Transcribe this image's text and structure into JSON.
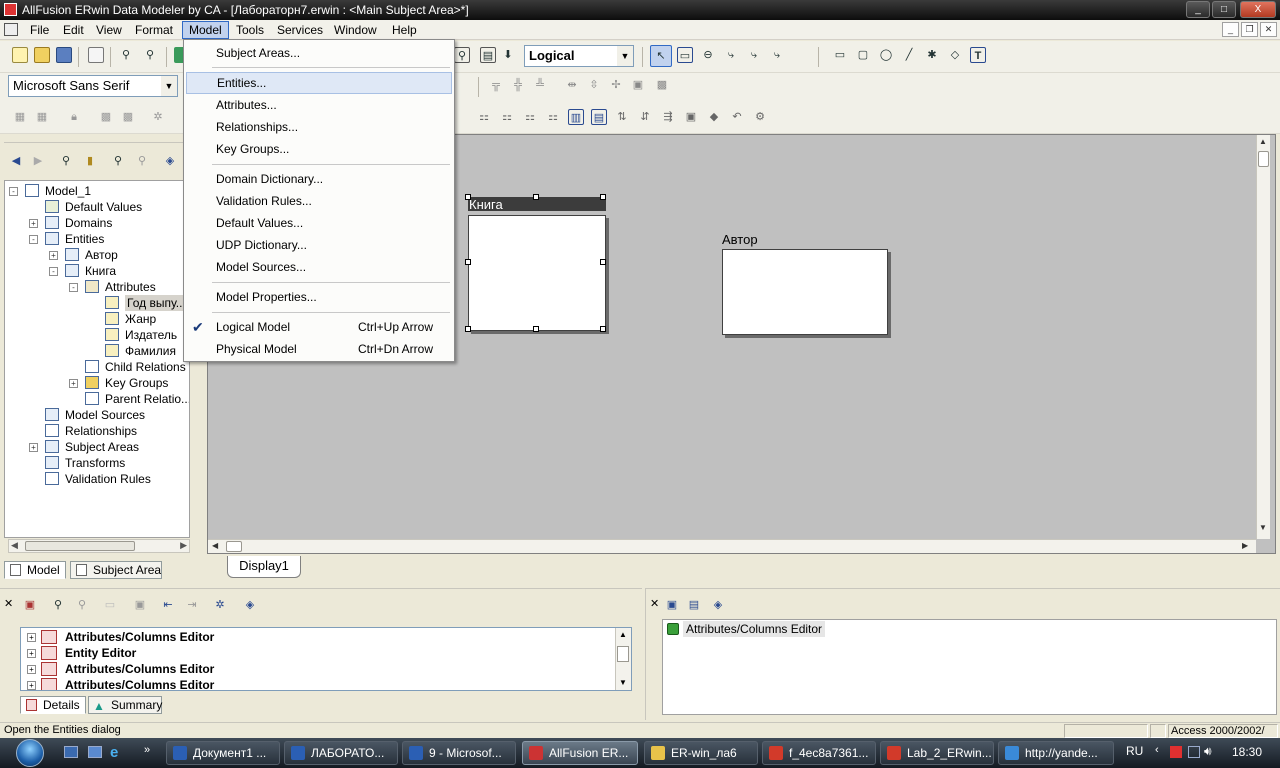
{
  "window": {
    "title": "AllFusion ERwin Data Modeler by CA - [Лабораторн7.erwin : <Main Subject Area>*]",
    "controls": {
      "minimize": "_",
      "maximize": "□",
      "close": "X"
    }
  },
  "menubar": {
    "items": [
      "File",
      "Edit",
      "View",
      "Format",
      "Model",
      "Tools",
      "Services",
      "Window",
      "Help"
    ],
    "active": "Model"
  },
  "toolbar": {
    "model_type_value": "Logical",
    "font_value": "Microsoft Sans Serif"
  },
  "model_menu": {
    "items": [
      {
        "label": "Subject Areas...",
        "shortcut": ""
      },
      {
        "label": "Entities...",
        "shortcut": "",
        "highlighted": true
      },
      {
        "label": "Attributes...",
        "shortcut": ""
      },
      {
        "label": "Relationships...",
        "shortcut": ""
      },
      {
        "label": "Key Groups...",
        "shortcut": ""
      },
      {
        "label": "Domain Dictionary...",
        "shortcut": ""
      },
      {
        "label": "Validation Rules...",
        "shortcut": ""
      },
      {
        "label": "Default Values...",
        "shortcut": ""
      },
      {
        "label": "UDP Dictionary...",
        "shortcut": ""
      },
      {
        "label": "Model Sources...",
        "shortcut": ""
      },
      {
        "label": "Model Properties...",
        "shortcut": ""
      },
      {
        "label": "Logical Model",
        "shortcut": "Ctrl+Up Arrow",
        "checked": true
      },
      {
        "label": "Physical Model",
        "shortcut": "Ctrl+Dn Arrow"
      }
    ]
  },
  "tree": {
    "items": [
      {
        "label": "Model_1",
        "expander": "-"
      },
      {
        "label": "Default Values",
        "expander": ""
      },
      {
        "label": "Domains",
        "expander": "+"
      },
      {
        "label": "Entities",
        "expander": "-"
      },
      {
        "label": "Автор",
        "expander": "+"
      },
      {
        "label": "Книга",
        "expander": "-"
      },
      {
        "label": "Attributes",
        "expander": "-"
      },
      {
        "label": "Год выпу...",
        "expander": "",
        "selected": true
      },
      {
        "label": "Жанр",
        "expander": ""
      },
      {
        "label": "Издатель",
        "expander": ""
      },
      {
        "label": "Фамилия",
        "expander": ""
      },
      {
        "label": "Child Relations",
        "expander": ""
      },
      {
        "label": "Key Groups",
        "expander": "+"
      },
      {
        "label": "Parent Relatio...",
        "expander": ""
      },
      {
        "label": "Model Sources",
        "expander": ""
      },
      {
        "label": "Relationships",
        "expander": ""
      },
      {
        "label": "Subject Areas",
        "expander": "+"
      },
      {
        "label": "Transforms",
        "expander": ""
      },
      {
        "label": "Validation Rules",
        "expander": ""
      }
    ],
    "tabs": [
      "Model",
      "Subject Area"
    ],
    "active_tab": "Model"
  },
  "canvas": {
    "entities": [
      {
        "name": "Книга",
        "selected": true
      },
      {
        "name": "Автор",
        "selected": false
      }
    ],
    "display_tab": "Display1"
  },
  "action_log": {
    "items": [
      "Attributes/Columns Editor",
      "Entity Editor",
      "Attributes/Columns Editor",
      "Attributes/Columns Editor"
    ],
    "tabs": [
      "Details",
      "Summary"
    ]
  },
  "right_log": {
    "items": [
      "Attributes/Columns Editor"
    ]
  },
  "statusbar": {
    "message": "Open the Entities dialog",
    "db": "Access 2000/2002/"
  },
  "taskbar": {
    "buttons": [
      {
        "label": "Документ1 ...",
        "active": false,
        "color": "#2b5fb4"
      },
      {
        "label": "ЛАБОРАТО...",
        "active": false,
        "color": "#2b5fb4"
      },
      {
        "label": "9 - Microsof...",
        "active": false,
        "color": "#2b5fb4"
      },
      {
        "label": "AllFusion ER...",
        "active": true,
        "color": "#cc3333"
      },
      {
        "label": "ER-win_ла6",
        "active": false,
        "color": "#e8c24a"
      },
      {
        "label": "f_4ec8a7361...",
        "active": false,
        "color": "#d23a2a"
      },
      {
        "label": "Lab_2_ERwin...",
        "active": false,
        "color": "#d23a2a"
      },
      {
        "label": "http://yande...",
        "active": false,
        "color": "#3a8ad8"
      }
    ],
    "lang": "RU",
    "clock": "18:30"
  },
  "colors": {
    "title_bar": "#0d0d0d",
    "menu_highlight": "#dfe8f6",
    "canvas_bg": "#c0c0c0",
    "selected_entity_header": "#3c3c3c"
  }
}
